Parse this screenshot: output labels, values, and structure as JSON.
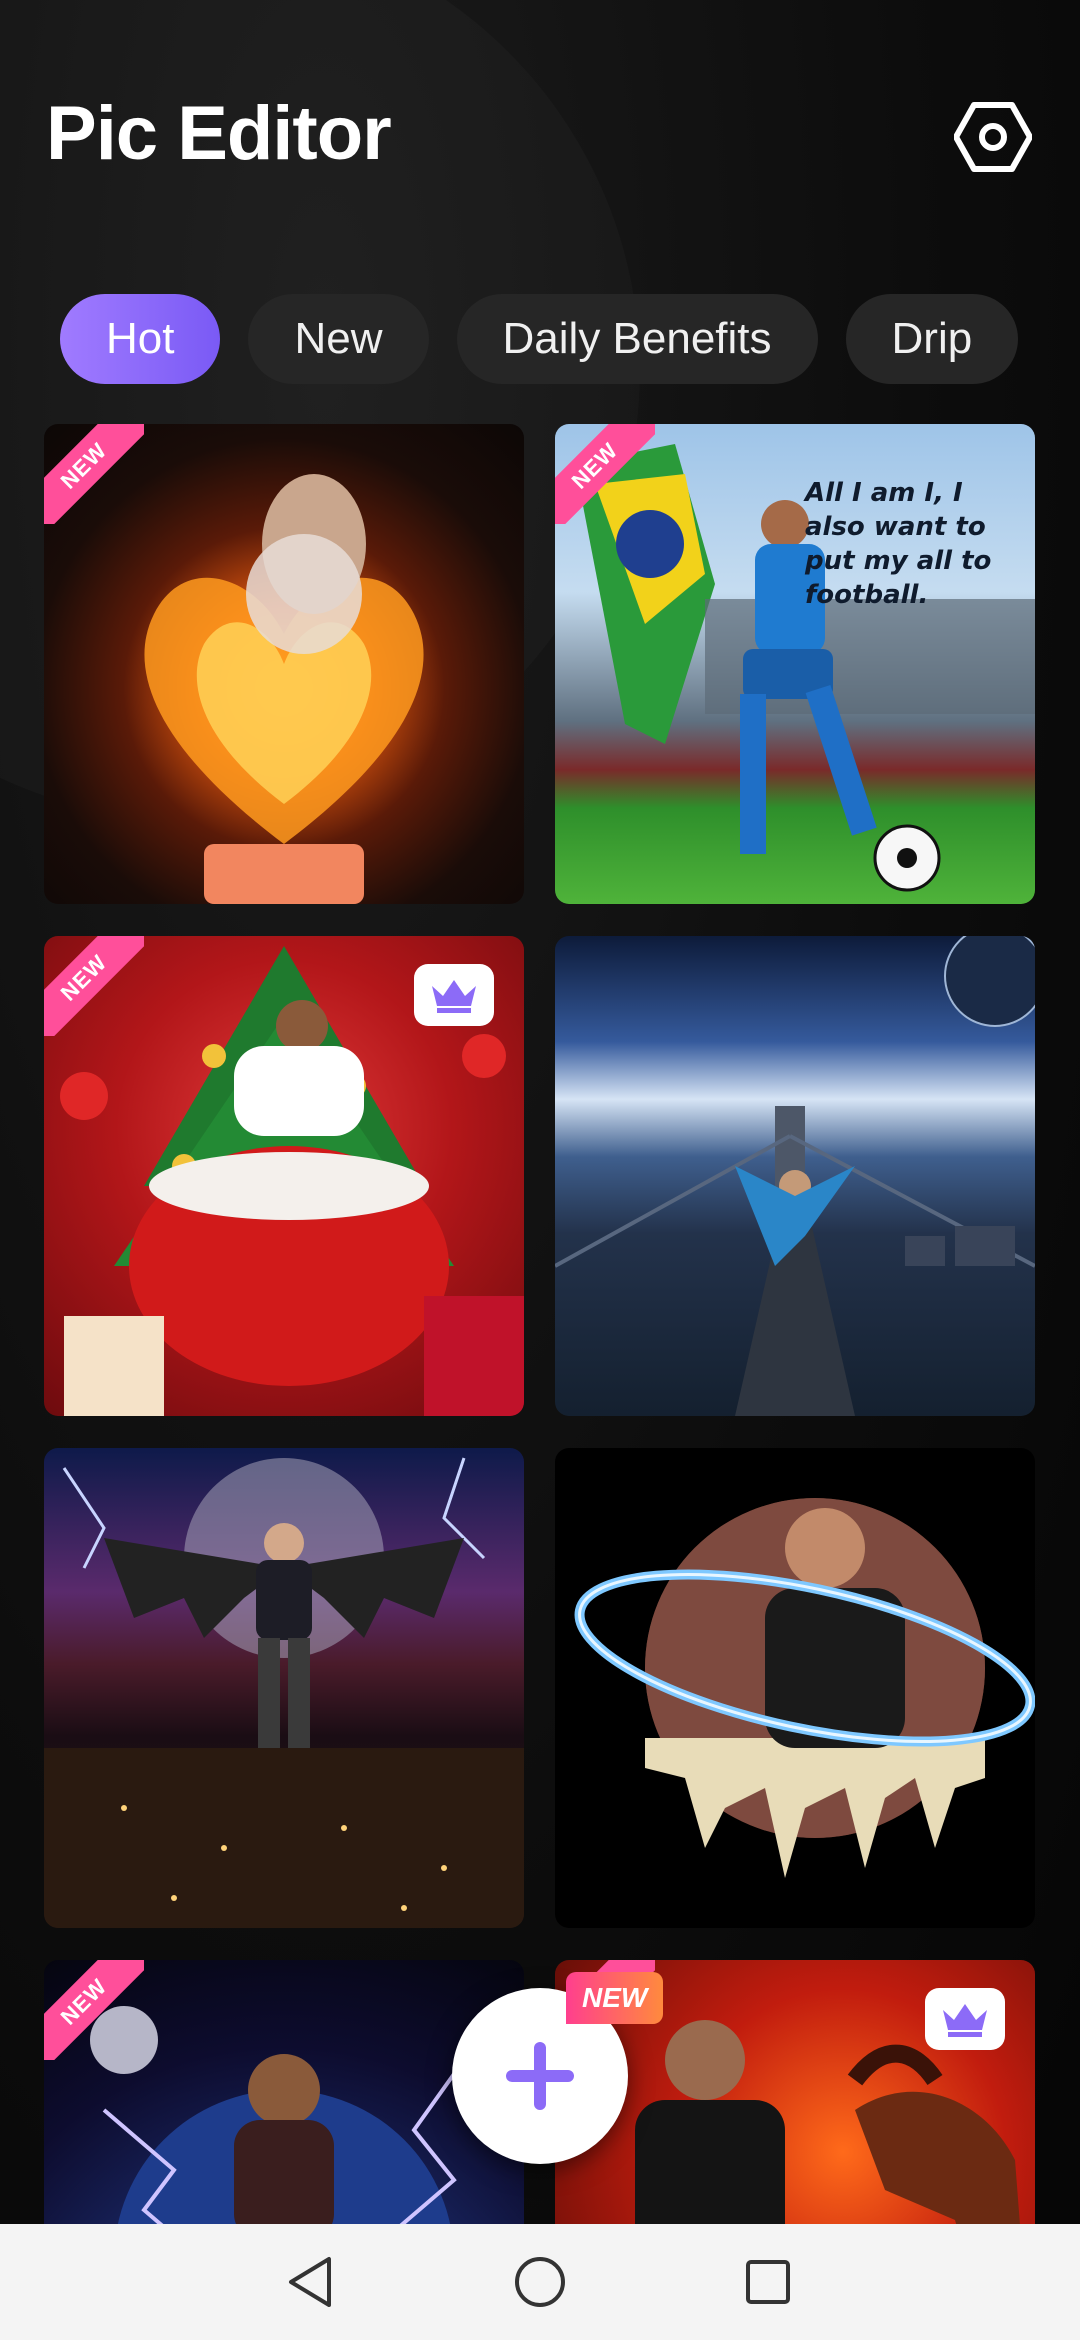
{
  "app": {
    "title": "Pic Editor"
  },
  "tabs": [
    {
      "label": "Hot",
      "active": true
    },
    {
      "label": "New",
      "active": false
    },
    {
      "label": "Daily Benefits",
      "active": false
    },
    {
      "label": "Drip",
      "active": false
    }
  ],
  "badges": {
    "new": "NEW"
  },
  "cards": [
    {
      "name": "fire-heart-woman",
      "badge": "NEW",
      "premium": false
    },
    {
      "name": "football-brazil",
      "badge": "NEW",
      "premium": false,
      "quote": "All I am I, I also want to put my all to football."
    },
    {
      "name": "christmas-gift-bag",
      "badge": "NEW",
      "premium": true
    },
    {
      "name": "bridge-breakdance",
      "badge": "",
      "premium": false
    },
    {
      "name": "bat-wings-city",
      "badge": "",
      "premium": false
    },
    {
      "name": "planet-ring-drip",
      "badge": "",
      "premium": false
    },
    {
      "name": "lightning-earth",
      "badge": "NEW",
      "premium": false
    },
    {
      "name": "fire-horse",
      "badge": "NEW",
      "premium": true
    }
  ],
  "fab": {
    "badge": "NEW",
    "icon": "plus-icon"
  },
  "colors": {
    "accent": "#8c6bf7",
    "newBadge": "#ff4f9a"
  }
}
